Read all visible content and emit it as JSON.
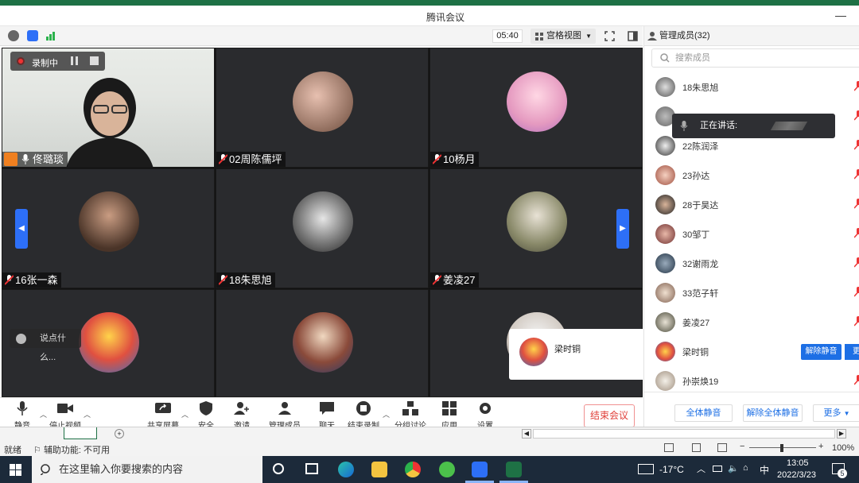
{
  "window": {
    "title": "腾讯会议"
  },
  "topbar": {
    "timer": "05:40",
    "view_label": "宫格视图"
  },
  "recording": {
    "label": "录制中"
  },
  "tiles": [
    {
      "name": "佟璐琰"
    },
    {
      "name": "02周陈儒坪"
    },
    {
      "name": "10杨月"
    },
    {
      "name": "16张一森"
    },
    {
      "name": "18朱思旭"
    },
    {
      "name": "姜凌27"
    },
    {
      "name": ""
    },
    {
      "name": ""
    },
    {
      "name": ""
    }
  ],
  "chat": {
    "placeholder": "说点什么..."
  },
  "speaker_popup": {
    "name": "梁时铜"
  },
  "toolbar": {
    "mute": "静音",
    "stop_video": "停止视频",
    "share_screen": "共享屏幕",
    "security": "安全",
    "invite": "邀请",
    "manage_members": "管理成员(32)",
    "chat": "聊天",
    "end_record": "结束录制",
    "breakout": "分组讨论",
    "apps": "应用",
    "settings": "设置",
    "end_meeting": "结束会议"
  },
  "panel": {
    "title": "管理成员(32)",
    "search_placeholder": "搜索成员",
    "speaking_label": "正在讲话:",
    "members": [
      {
        "name": "18朱思旭"
      },
      {
        "name": ""
      },
      {
        "name": "22陈润泽"
      },
      {
        "name": "23孙达"
      },
      {
        "name": "28于昊达"
      },
      {
        "name": "30邹丁"
      },
      {
        "name": "32谢雨龙"
      },
      {
        "name": "33范子轩"
      },
      {
        "name": "姜凌27"
      },
      {
        "name": "梁时铜"
      },
      {
        "name": "孙崇焕19"
      }
    ],
    "unmute_label": "解除静音",
    "more_short": "更",
    "footer": {
      "mute_all": "全体静音",
      "unmute_all": "解除全体静音",
      "more": "更多"
    }
  },
  "excel": {
    "status_ready": "就绪",
    "accessibility": "辅助功能: 不可用",
    "zoom": "100%"
  },
  "taskbar": {
    "search_placeholder": "在这里输入你要搜索的内容",
    "weather": "-17°C",
    "ime": "中",
    "time": "13:05",
    "date": "2022/3/23",
    "notifications": "5"
  },
  "colors": {
    "accent": "#1d6fe5",
    "end_red": "#e0403a",
    "tile_bg": "#2a2b2e"
  }
}
